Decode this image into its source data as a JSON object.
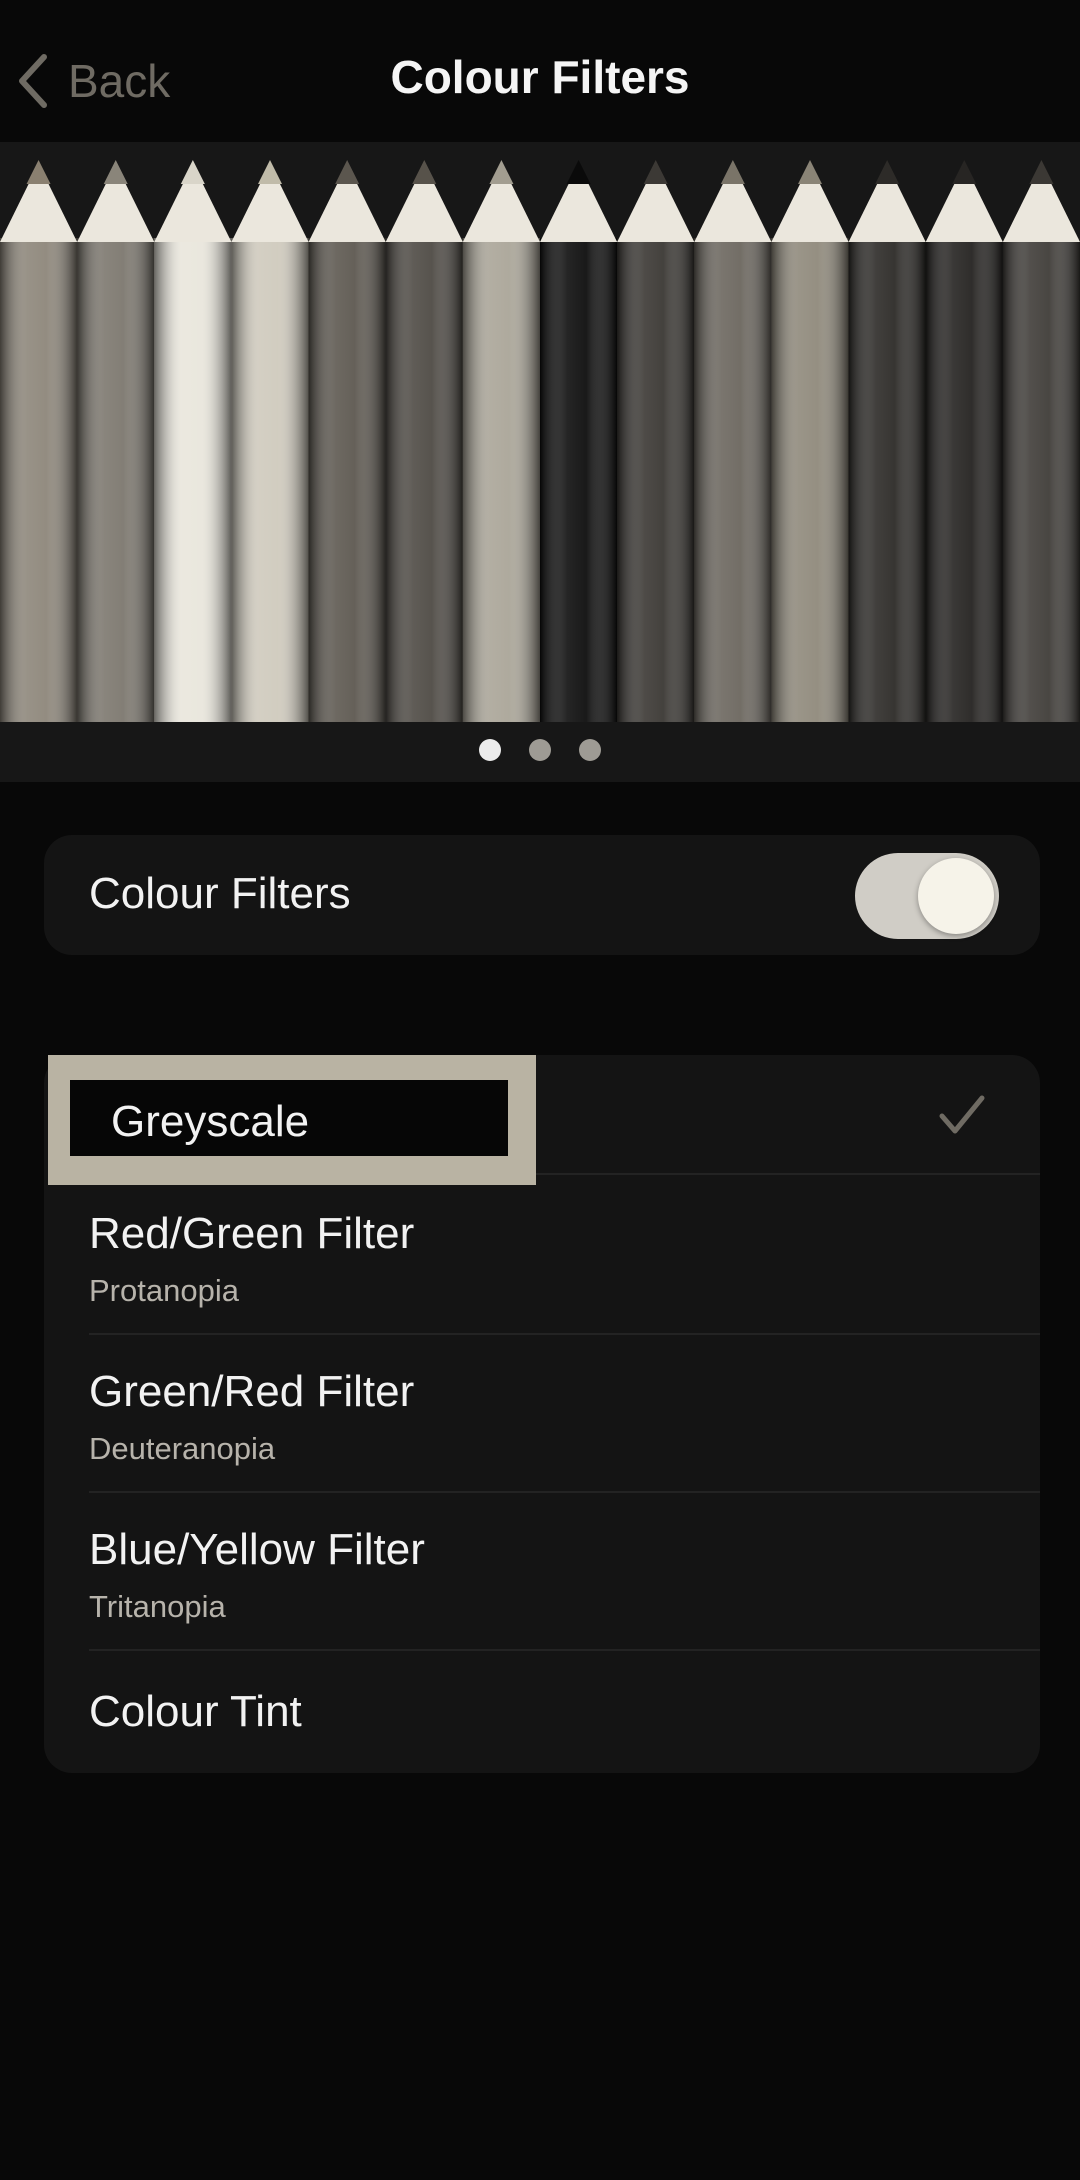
{
  "nav": {
    "back_label": "Back",
    "title": "Colour Filters"
  },
  "banner": {
    "pages_count": 3,
    "active_page": 1
  },
  "toggle": {
    "label": "Colour Filters",
    "on": true
  },
  "filters": [
    {
      "title": "Greyscale",
      "selected": true
    },
    {
      "title": "Red/Green Filter",
      "subtitle": "Protanopia",
      "selected": false
    },
    {
      "title": "Green/Red Filter",
      "subtitle": "Deuteranopia",
      "selected": false
    },
    {
      "title": "Blue/Yellow Filter",
      "subtitle": "Tritanopia",
      "selected": false
    },
    {
      "title": "Colour Tint",
      "selected": false
    }
  ],
  "colors": {
    "background": "#080808",
    "group_background": "#141414",
    "accent_muted": "#6f6b63",
    "highlight_frame": "#b9b3a3",
    "switch_track_on": "#d0cdc6"
  },
  "icons": {
    "back": "chevron-left-icon",
    "selected": "checkmark-icon"
  }
}
